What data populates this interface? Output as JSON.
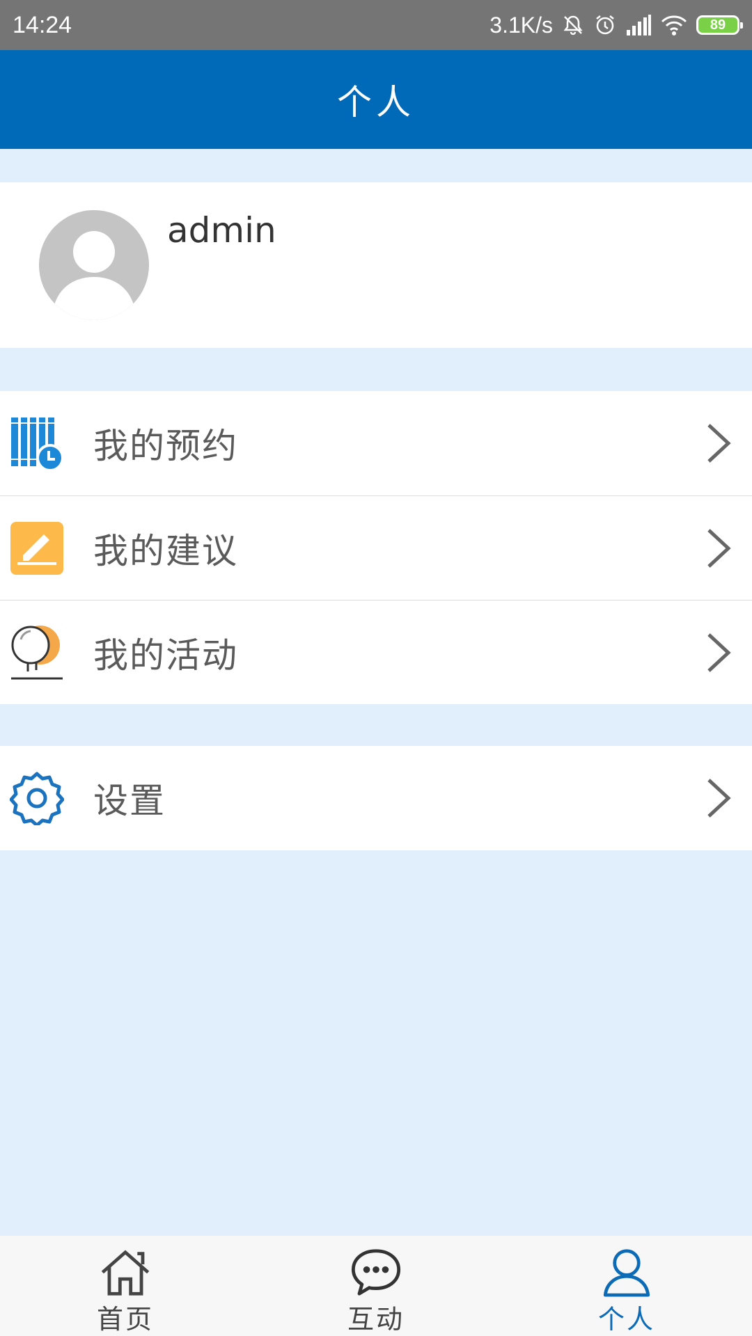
{
  "status_bar": {
    "time": "14:24",
    "speed": "3.1K/s",
    "battery": "89",
    "icons": [
      "mute-icon",
      "alarm-icon",
      "signal-icon",
      "wifi-icon",
      "battery-icon"
    ]
  },
  "header": {
    "title": "个人"
  },
  "profile": {
    "username": "admin"
  },
  "menu_group_1": {
    "items": [
      {
        "label": "我的预约",
        "icon": "calendar-clock-icon"
      },
      {
        "label": "我的建议",
        "icon": "edit-pencil-icon"
      },
      {
        "label": "我的活动",
        "icon": "balloon-icon"
      }
    ]
  },
  "menu_group_2": {
    "items": [
      {
        "label": "设置",
        "icon": "gear-icon"
      }
    ]
  },
  "bottom_nav": {
    "items": [
      {
        "label": "首页",
        "icon": "home-icon"
      },
      {
        "label": "互动",
        "icon": "chat-icon"
      },
      {
        "label": "个人",
        "icon": "user-icon",
        "active": true
      }
    ]
  },
  "colors": {
    "primary": "#0069b8",
    "background": "#e1eefc",
    "status_bar": "#757575",
    "active_nav": "#0c6bb7"
  }
}
